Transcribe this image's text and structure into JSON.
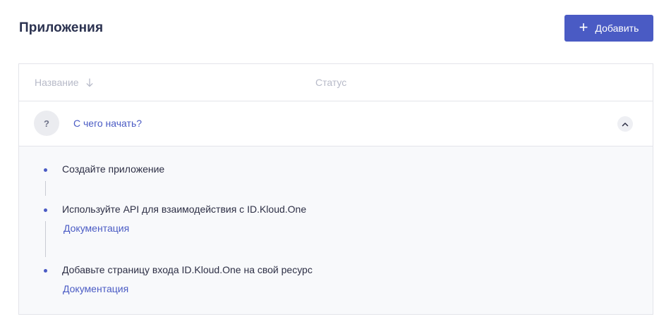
{
  "header": {
    "title": "Приложения",
    "add_button": {
      "label": "Добавить",
      "icon": "plus-icon"
    }
  },
  "table": {
    "columns": [
      {
        "label": "Название",
        "sort": "descending",
        "icon": "arrow-down-icon"
      },
      {
        "label": "Статус"
      }
    ],
    "row": {
      "avatar": "?",
      "title": "С чего начать?",
      "expanded": true,
      "toggle_icon": "chevron-up-icon"
    },
    "steps": [
      {
        "text": "Создайте приложение"
      },
      {
        "text": "Используйте API для взаимодействия с ID.Kloud.One",
        "link": "Документация"
      },
      {
        "text": "Добавьте страницу входа ID.Kloud.One на свой ресурс",
        "link": "Документация"
      }
    ]
  },
  "colors": {
    "accent": "#4a5bc4",
    "border": "#e3e4ea",
    "panel_bg": "#f8f9fb",
    "muted_text": "#b7bac8"
  }
}
